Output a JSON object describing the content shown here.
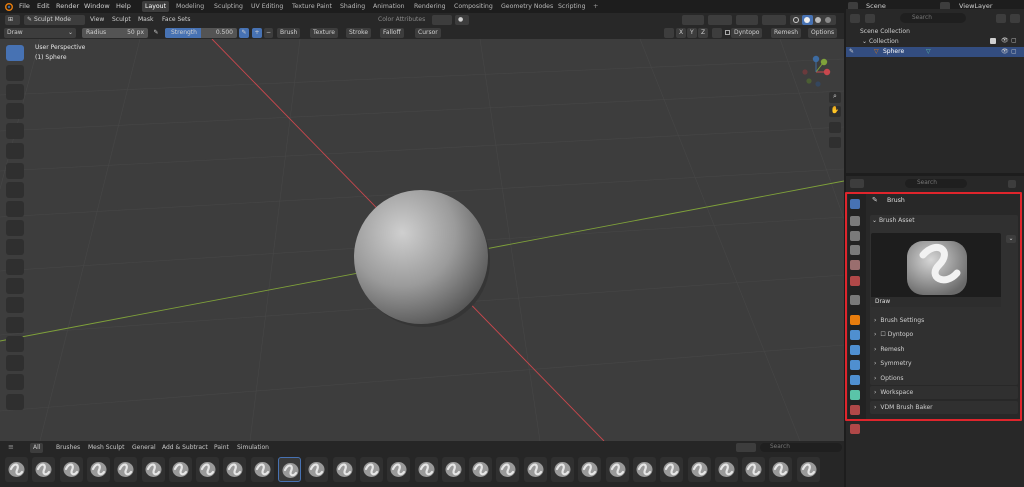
{
  "menu": {
    "items": [
      "File",
      "Edit",
      "Render",
      "Window",
      "Help"
    ]
  },
  "workspaces": [
    "Layout",
    "Modeling",
    "Sculpting",
    "UV Editing",
    "Texture Paint",
    "Shading",
    "Animation",
    "Rendering",
    "Compositing",
    "Geometry Nodes",
    "Scripting"
  ],
  "scene": {
    "name": "Scene",
    "view_layer": "ViewLayer"
  },
  "viewport_header": {
    "mode": "Sculpt Mode",
    "menus": [
      "View",
      "Sculpt",
      "Mask",
      "Face Sets"
    ],
    "color_attributes": "Color Attributes"
  },
  "tool_header": {
    "brush": "Draw",
    "radius_label": "Radius",
    "radius_value": "50 px",
    "strength_label": "Strength",
    "strength_value": "0.500",
    "dropdowns": [
      "Brush",
      "Texture",
      "Stroke",
      "Falloff",
      "Cursor"
    ],
    "axes": [
      "X",
      "Y",
      "Z"
    ],
    "dyntopo": "Dyntopo",
    "remesh": "Remesh",
    "options": "Options"
  },
  "viewport": {
    "perspective": "User Perspective",
    "object": "(1) Sphere"
  },
  "shelf": {
    "tabs": [
      "All",
      "Brushes",
      "Mesh Sculpt",
      "General",
      "Add & Subtract",
      "Paint",
      "Simulation"
    ],
    "search_placeholder": "Search"
  },
  "outliner": {
    "search_placeholder": "Search",
    "scene_collection": "Scene Collection",
    "collection": "Collection",
    "object": "Sphere"
  },
  "properties": {
    "search_placeholder": "Search",
    "brush_title": "Brush",
    "brush_asset_label": "Brush Asset",
    "brush_name": "Draw",
    "panels": [
      "Brush Settings",
      "Dyntopo",
      "Remesh",
      "Symmetry",
      "Options",
      "Workspace",
      "VDM Brush Baker"
    ]
  },
  "colors": {
    "accent": "#4772b3",
    "highlight": "#e0252c",
    "x_axis": "#c8474d",
    "y_axis": "#7fa13a"
  }
}
